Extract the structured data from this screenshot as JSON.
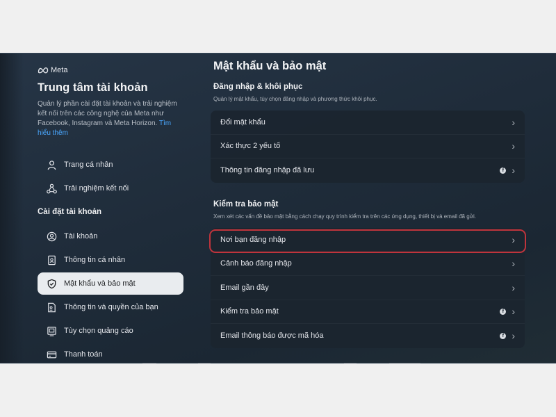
{
  "brand": {
    "logo_text": "Meta"
  },
  "sidebar": {
    "title": "Trung tâm tài khoản",
    "description": "Quản lý phần cài đặt tài khoản và trải nghiệm kết nối trên các công nghệ của Meta như Facebook, Instagram và Meta Horizon.",
    "learn_more": "Tìm hiểu thêm",
    "top_items": [
      {
        "label": "Trang cá nhân",
        "icon": "person-icon"
      },
      {
        "label": "Trải nghiệm kết nối",
        "icon": "connected-experiences-icon"
      }
    ],
    "section_heading": "Cài đặt tài khoản",
    "settings_items": [
      {
        "label": "Tài khoản",
        "icon": "account-circle-icon",
        "active": false
      },
      {
        "label": "Thông tin cá nhân",
        "icon": "id-card-icon",
        "active": false
      },
      {
        "label": "Mật khẩu và bảo mật",
        "icon": "shield-icon",
        "active": true
      },
      {
        "label": "Thông tin và quyền của bạn",
        "icon": "info-permissions-icon",
        "active": false
      },
      {
        "label": "Tùy chọn quảng cáo",
        "icon": "ad-preferences-icon",
        "active": false
      },
      {
        "label": "Thanh toán",
        "icon": "credit-card-icon",
        "active": false
      }
    ]
  },
  "main": {
    "title": "Mật khẩu và bảo mật",
    "login_recovery": {
      "title": "Đăng nhập & khôi phục",
      "description": "Quản lý mật khẩu, tùy chọn đăng nhập và phương thức khôi phục.",
      "rows": [
        {
          "label": "Đổi mật khẩu",
          "facebook_badge": false
        },
        {
          "label": "Xác thực 2 yếu tố",
          "facebook_badge": false
        },
        {
          "label": "Thông tin đăng nhập đã lưu",
          "facebook_badge": true
        }
      ]
    },
    "security_checks": {
      "title": "Kiểm tra bảo mật",
      "description": "Xem xét các vấn đề bảo mật bằng cách chạy quy trình kiểm tra trên các ứng dụng, thiết bị và email đã gửi.",
      "rows": [
        {
          "label": "Nơi bạn đăng nhập",
          "facebook_badge": false,
          "highlighted": true
        },
        {
          "label": "Cảnh báo đăng nhập",
          "facebook_badge": false
        },
        {
          "label": "Email gần đây",
          "facebook_badge": false
        },
        {
          "label": "Kiểm tra bảo mật",
          "facebook_badge": true
        },
        {
          "label": "Email thông báo được mã hóa",
          "facebook_badge": true
        }
      ]
    }
  },
  "icons": {
    "chevron": "›",
    "facebook_glyph": "f"
  },
  "colors": {
    "highlight": "#c0343c",
    "link": "#4aa8ff",
    "active_nav_bg": "#e9ecef"
  }
}
